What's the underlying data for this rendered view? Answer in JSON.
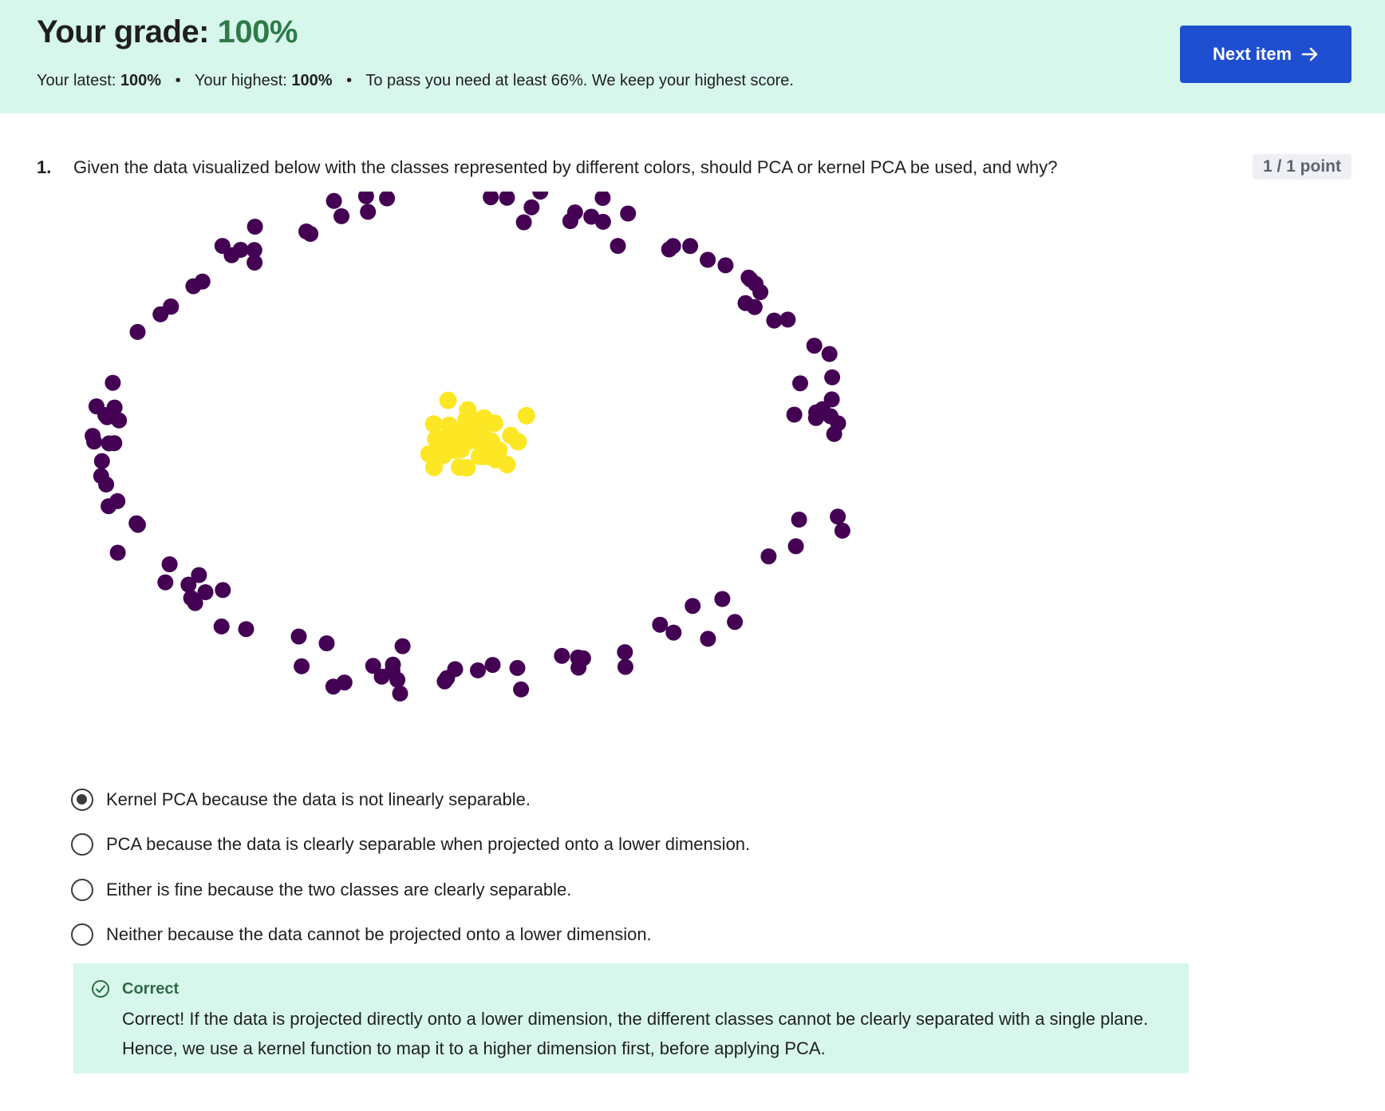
{
  "grade": {
    "title_label": "Your grade: ",
    "title_value": "100%",
    "latest_label": "Your latest: ",
    "latest_value": "100%",
    "highest_label": "Your highest: ",
    "highest_value": "100%",
    "separator": "•",
    "pass_note": "To pass you need at least 66%. We keep your highest score.",
    "next_button_label": "Next item"
  },
  "question": {
    "number": "1.",
    "text": "Given the data visualized below with the classes represented by different colors, should PCA or kernel PCA be used, and why?",
    "points": "1 / 1 point"
  },
  "chart_data": {
    "type": "scatter",
    "title": "",
    "xlabel": "",
    "ylabel": "",
    "grid": false,
    "axes_visible": false,
    "colors": {
      "outer_ring": "#440154",
      "inner_cluster": "#fde725"
    },
    "series": [
      {
        "class": "outer_ring",
        "shape": "ring",
        "count": 120,
        "cx": 0,
        "cy": 0,
        "rx": 0.95,
        "ry": 0.62,
        "spread": 0.03,
        "seed": 11
      },
      {
        "class": "inner_cluster",
        "shape": "blob",
        "count": 55,
        "cx": 0,
        "cy": 0,
        "spread": 0.05,
        "seed": 7
      }
    ]
  },
  "options": [
    {
      "label": "Kernel PCA because the data is not linearly separable.",
      "selected": true
    },
    {
      "label": "PCA because the data is clearly separable when projected onto a lower dimension.",
      "selected": false
    },
    {
      "label": "Either is fine because the two classes are clearly separable.",
      "selected": false
    },
    {
      "label": "Neither because the data cannot be projected onto a lower dimension.",
      "selected": false
    }
  ],
  "feedback": {
    "status": "Correct",
    "text": "Correct! If the data is projected directly onto a lower dimension, the different classes cannot be clearly separated with a single plane. Hence, we use a kernel function to map it to a higher dimension first, before applying PCA.",
    "color": "#2f6b45"
  }
}
